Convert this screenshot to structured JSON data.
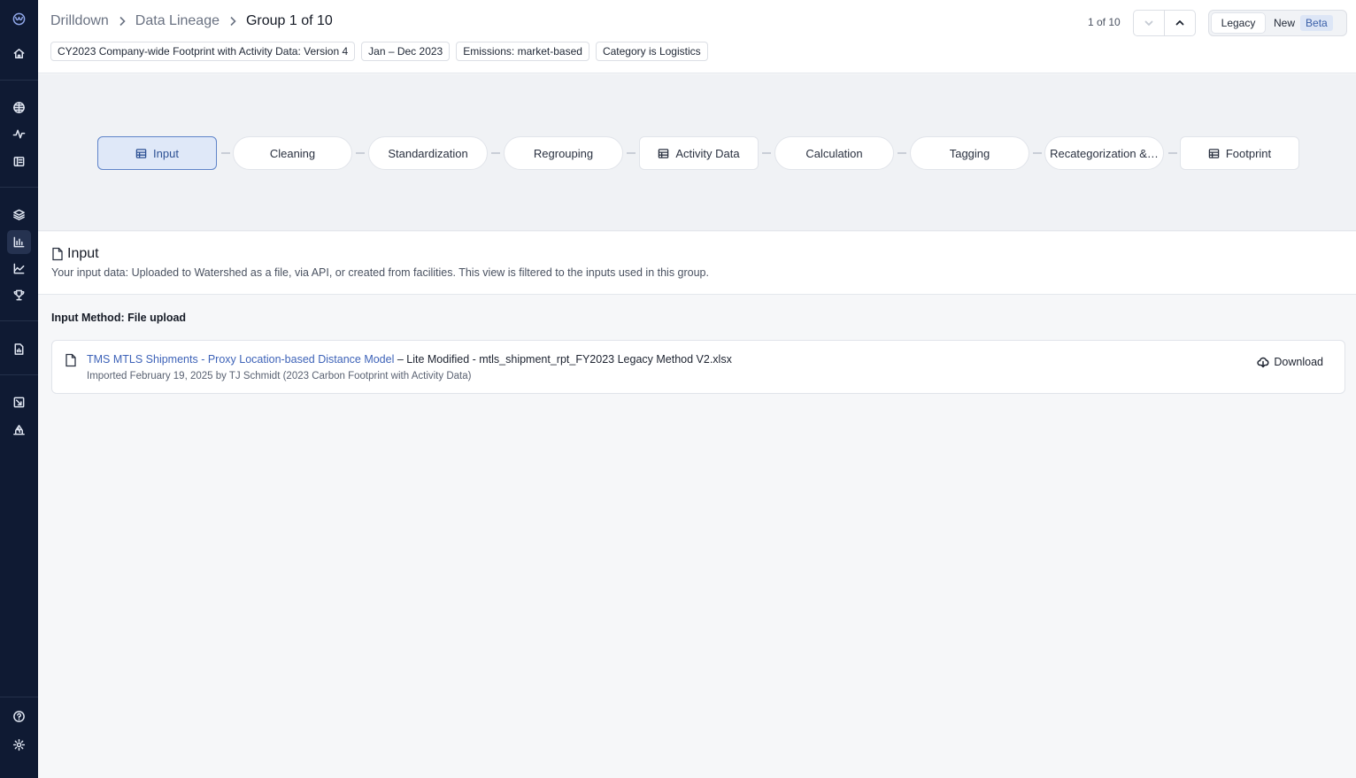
{
  "sidebar": {
    "items": [
      {
        "icon": "watershed-logo-icon"
      },
      {
        "icon": "home-icon"
      },
      {
        "icon": "globe-grid-icon"
      },
      {
        "icon": "activity-icon"
      },
      {
        "icon": "ledger-icon"
      },
      {
        "icon": "layers-icon"
      },
      {
        "icon": "bar-chart-icon"
      },
      {
        "icon": "area-chart-icon"
      },
      {
        "icon": "trophy-icon"
      },
      {
        "icon": "report-document-icon"
      },
      {
        "icon": "trend-down-icon"
      },
      {
        "icon": "supplier-icon"
      },
      {
        "icon": "help-icon"
      },
      {
        "icon": "settings-icon"
      }
    ],
    "active_item": "bar-chart-icon"
  },
  "breadcrumb": {
    "items": [
      "Drilldown",
      "Data Lineage"
    ],
    "current": "Group 1 of 10"
  },
  "filters": [
    "CY2023 Company-wide Footprint with Activity Data: Version 4",
    "Jan – Dec 2023",
    "Emissions: market-based",
    "Category is Logistics"
  ],
  "pager": {
    "count": "1 of 10",
    "prev_icon": "chevron-down-icon",
    "next_icon": "chevron-up-icon"
  },
  "version_toggle": {
    "legacy": "Legacy",
    "new": "New",
    "beta": "Beta"
  },
  "pipeline": {
    "selected": "Input",
    "stages": [
      {
        "label": "Input",
        "icon": "table-icon"
      },
      {
        "label": "Cleaning"
      },
      {
        "label": "Standardization"
      },
      {
        "label": "Regrouping"
      },
      {
        "label": "Activity Data",
        "icon": "table-icon"
      },
      {
        "label": "Calculation"
      },
      {
        "label": "Tagging"
      },
      {
        "label": "Recategorization &…"
      },
      {
        "label": "Footprint",
        "icon": "table-icon"
      }
    ]
  },
  "input_section": {
    "title": "Input",
    "description": "Your input data: Uploaded to Watershed as a file, via API, or created from facilities. This view is filtered to the inputs used in this group.",
    "method_label": "Input Method: File upload"
  },
  "file": {
    "link_text": "TMS MTLS Shipments - Proxy Location-based Distance Model",
    "rest_text": " – Lite Modified - mtls_shipment_rpt_FY2023 Legacy Method V2.xlsx",
    "meta": "Imported February 19, 2025 by TJ Schmidt (2023 Carbon Footprint with Activity Data)",
    "download_label": "Download"
  },
  "colors": {
    "sidebar_bg": "#0f1a33",
    "accent": "#3e63b8",
    "selected_stage_bg": "#dfe8f8"
  }
}
